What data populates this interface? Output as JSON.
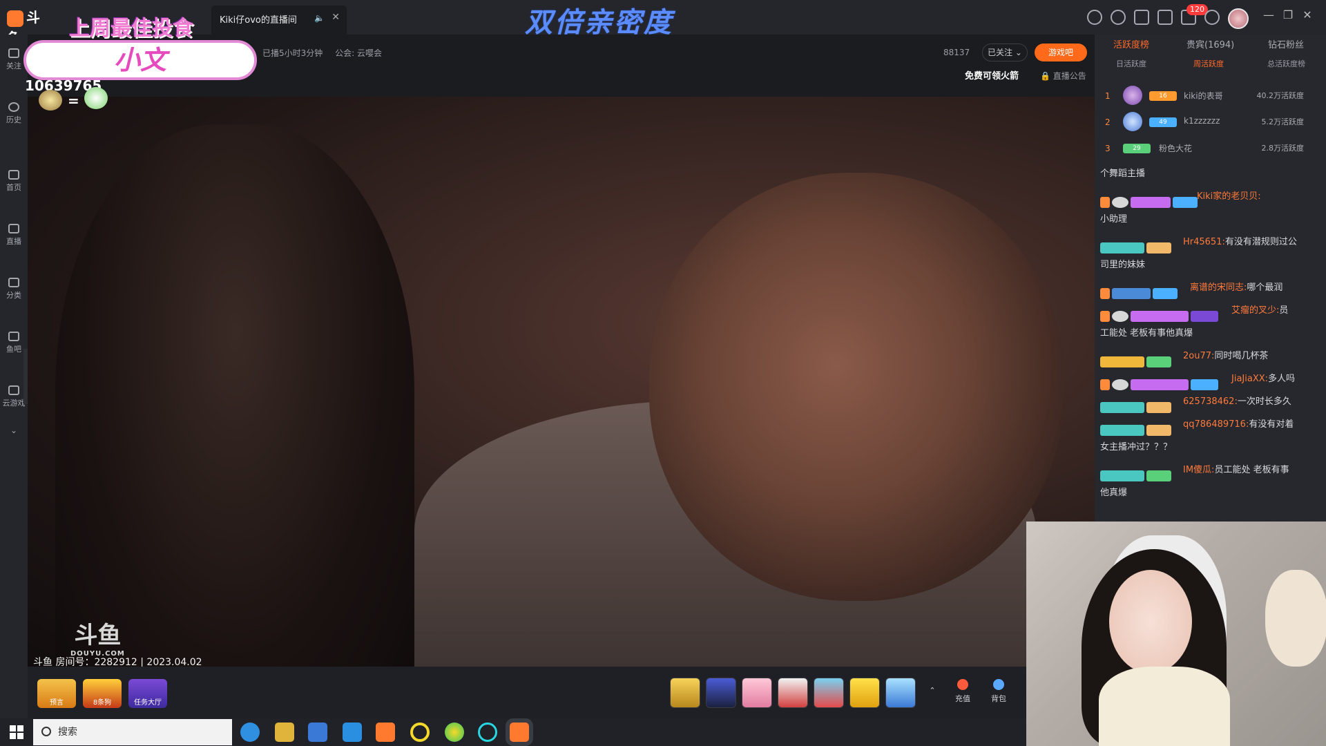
{
  "window": {
    "tab_title": "Kiki仔ovo的直播间",
    "banner": "双倍亲密度",
    "notification_count": "120"
  },
  "overlay": {
    "best_investor": "上周最佳投食",
    "name": "小文",
    "room_number_display": "10639765"
  },
  "nav": {
    "items": [
      {
        "label": "关注"
      },
      {
        "label": "历史"
      },
      {
        "label": "首页"
      },
      {
        "label": "直播"
      },
      {
        "label": "分类"
      },
      {
        "label": "鱼吧"
      },
      {
        "label": "云游戏"
      }
    ]
  },
  "room": {
    "live_duration": "已播5小时3分钟",
    "guild": "公会: 云嘤会",
    "viewers": "88137",
    "follow_label": "已关注",
    "game_label": "游戏吧",
    "free_rocket": "免费可领火箭",
    "announcement": "直播公告"
  },
  "video": {
    "watermark": "斗鱼",
    "watermark_sub": "DOUYU.COM",
    "caption": "斗鱼 房间号：2282912 | 2023.04.02"
  },
  "giftbar": {
    "left_items": [
      {
        "label": "预言"
      },
      {
        "label": "8条狗"
      },
      {
        "label": "任务大厅"
      }
    ],
    "recharge_label": "充值",
    "bag_label": "背包"
  },
  "right_panel": {
    "tabs": [
      "活跃度榜",
      "贵宾(1694)",
      "钻石粉丝"
    ],
    "sub_tabs": [
      "日活跃度",
      "周活跃度",
      "总活跃度榜"
    ],
    "ranks": [
      {
        "num": "1",
        "level": "16",
        "name": "kiki的表哥",
        "score": "40.2万活跃度"
      },
      {
        "num": "2",
        "level": "49",
        "name": "k1zzzzzz",
        "score": "5.2万活跃度"
      },
      {
        "num": "3",
        "level": "29",
        "name": "粉色大花",
        "score": "2.8万活跃度"
      }
    ],
    "chat": [
      {
        "user": "",
        "content": "个舞蹈主播"
      },
      {
        "user": "Kiki家的老贝贝:",
        "content": ""
      },
      {
        "user": "",
        "content": "小助理"
      },
      {
        "user": "Hr45651:",
        "content": "有没有潜规则过公"
      },
      {
        "user": "",
        "content": "司里的妹妹"
      },
      {
        "user": "离谱的宋同志:",
        "content": "哪个最润"
      },
      {
        "user": "艾瘤的叉少:",
        "content": "员"
      },
      {
        "user": "",
        "content": "工能处 老板有事他真爆"
      },
      {
        "user": "2ou77:",
        "content": "同时喝几杯茶"
      },
      {
        "user": "JiaJiaXX:",
        "content": "多人吗"
      },
      {
        "user": "625738462:",
        "content": "一次时长多久"
      },
      {
        "user": "qq786489716:",
        "content": "有没有对着"
      },
      {
        "user": "",
        "content": "女主播冲过？？？"
      },
      {
        "user": "IM傻瓜:",
        "content": "员工能处 老板有事"
      },
      {
        "user": "",
        "content": "他真爆"
      }
    ]
  },
  "taskbar": {
    "search_placeholder": "搜索"
  }
}
